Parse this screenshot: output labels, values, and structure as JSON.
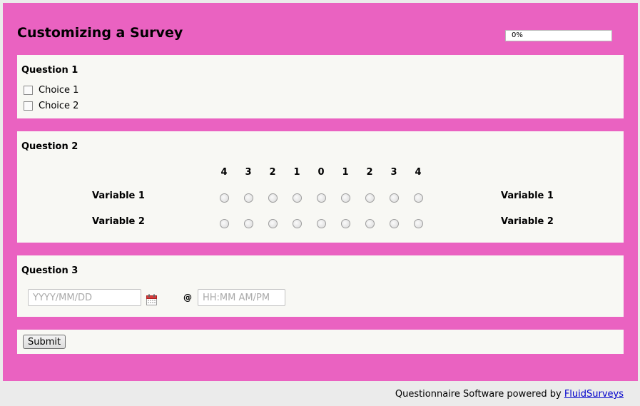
{
  "survey": {
    "title": "Customizing a Survey",
    "progress_text": "0%",
    "progress_fraction": 0
  },
  "question1": {
    "title": "Question 1",
    "choices": [
      "Choice 1",
      "Choice 2"
    ]
  },
  "question2": {
    "title": "Question 2",
    "scale": [
      "4",
      "3",
      "2",
      "1",
      "0",
      "1",
      "2",
      "3",
      "4"
    ],
    "rows": [
      {
        "left": "Variable 1",
        "right": "Variable 1"
      },
      {
        "left": "Variable 2",
        "right": "Variable 2"
      }
    ]
  },
  "question3": {
    "title": "Question 3",
    "date_placeholder": "YYYY/MM/DD",
    "at_label": "@",
    "time_placeholder": "HH:MM AM/PM"
  },
  "submit_label": "Submit",
  "footer": {
    "text": "Questionnaire Software powered by",
    "link_text": "FluidSurveys"
  },
  "colors": {
    "frame": "#ea62c1",
    "panel": "#f8f8f4",
    "page": "#ebebeb"
  },
  "icons": {
    "date_picker": "calendar-icon"
  }
}
